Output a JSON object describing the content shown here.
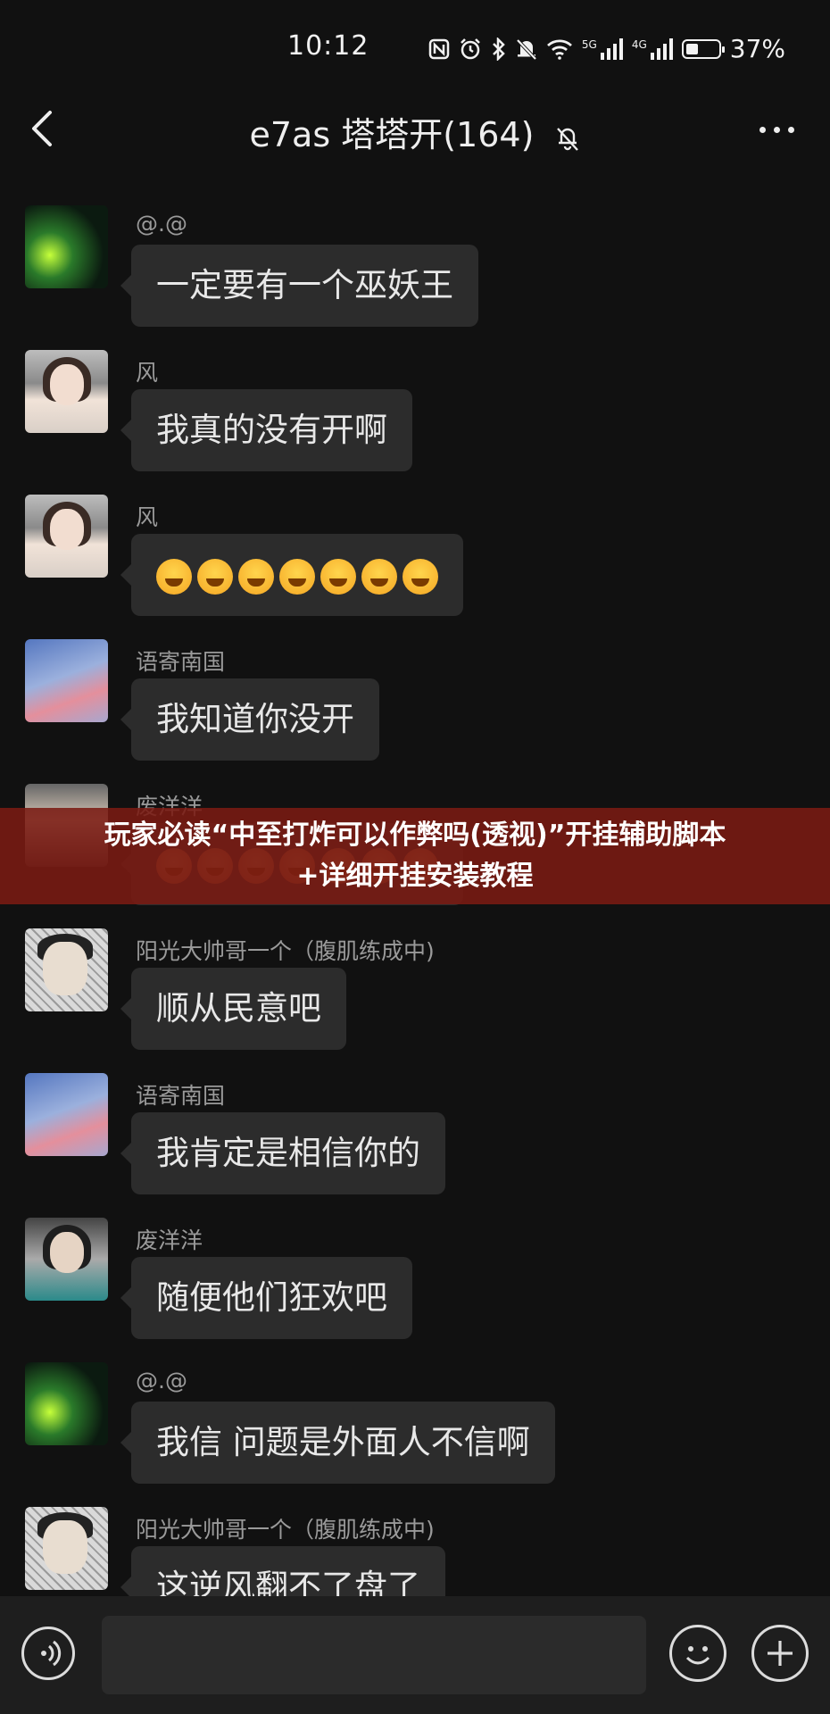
{
  "status_bar": {
    "time": "10:12",
    "signal_1_tag": "5G",
    "signal_2_tag": "4G",
    "battery_level": 37,
    "battery_text": "37%",
    "icons": [
      "nfc-icon",
      "alarm-icon",
      "bluetooth-icon",
      "mute-bell-icon",
      "wifi-icon",
      "signal-icon",
      "signal-icon",
      "battery-icon"
    ]
  },
  "header": {
    "title": "e7as 塔塔开(164)",
    "back_icon": "chevron-left-icon",
    "mute_icon": "bell-off-icon",
    "more_icon": "more-dots-icon"
  },
  "messages": [
    {
      "sender": "@.@",
      "text": "一定要有一个巫妖王",
      "avatar": "glow-jars"
    },
    {
      "sender": "风",
      "text": "我真的没有开啊",
      "avatar": "girl-photo"
    },
    {
      "sender": "风",
      "text": "",
      "emoji_count": 7,
      "emoji": "laughing-tears-emoji",
      "avatar": "girl-photo"
    },
    {
      "sender": "语寄南国",
      "text": "我知道你没开",
      "avatar": "sky-flowers"
    },
    {
      "sender": "废洋洋",
      "text": "",
      "emoji_count": 7,
      "emoji": "emoji",
      "avatar": "boy-photo"
    },
    {
      "sender": "阳光大帅哥一个（腹肌练成中)",
      "text": "顺从民意吧",
      "avatar": "chain-fence-boy"
    },
    {
      "sender": "语寄南国",
      "text": "我肯定是相信你的",
      "avatar": "sky-flowers"
    },
    {
      "sender": "废洋洋",
      "text": "随便他们狂欢吧",
      "avatar": "boy-photo"
    },
    {
      "sender": "@.@",
      "text": "我信 问题是外面人不信啊",
      "avatar": "glow-jars"
    },
    {
      "sender": "阳光大帅哥一个（腹肌练成中)",
      "text": "这逆风翻不了盘了",
      "avatar": "chain-fence-boy"
    }
  ],
  "overlay_banner": {
    "line1": "玩家必读“中至打炸可以作弊吗(透视)”开挂辅助脚本",
    "line2": "+详细开挂安装教程"
  },
  "input_bar": {
    "placeholder": "",
    "value": "",
    "voice_icon": "voice-icon",
    "emoji_icon": "smiley-icon",
    "plus_icon": "plus-icon"
  },
  "colors": {
    "background": "#111111",
    "bubble": "#2c2c2c",
    "banner": "#7a1a12",
    "sender_text": "#9a9a9a"
  }
}
